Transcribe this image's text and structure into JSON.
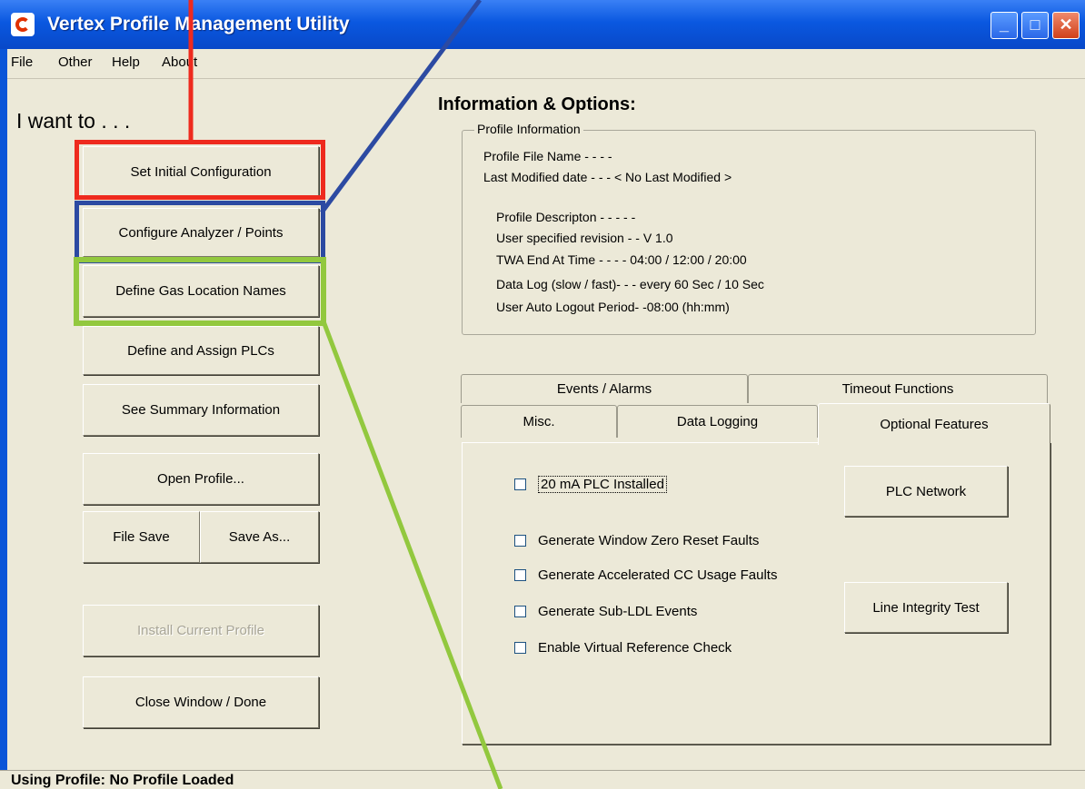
{
  "window": {
    "title": "Vertex Profile Management Utility",
    "buttons": {
      "minimize": "_",
      "maximize": "□",
      "close": "✕"
    }
  },
  "menu": [
    "File",
    "Other",
    "Help",
    "About"
  ],
  "left": {
    "heading": "I want to  . . .",
    "buttons": {
      "set_initial": "Set  Initial  Configuration",
      "configure_analyzer": "Configure  Analyzer / Points",
      "define_gas": "Define Gas Location Names",
      "define_plcs": "Define and Assign PLCs",
      "summary": "See  Summary  Information",
      "open_profile": "Open Profile...",
      "file_save": "File Save",
      "save_as": "Save As...",
      "install_profile": "Install Current Profile",
      "close_window": "Close Window / Done"
    }
  },
  "info": {
    "title": "Information & Options:",
    "group_label": "Profile Information",
    "file_name": "Profile File Name - - - -",
    "last_modified": "Last Modified date - - -    < No Last Modified >",
    "description": "Profile Descripton - - - - -",
    "revision": "User specified revision   - - V 1.0",
    "twa": "TWA End At Time - - - -  04:00  /  12:00  /  20:00",
    "datalog": "Data  Log (slow / fast)-  - - every 60 Sec / 10 Sec",
    "logout": "User Auto Logout Period-  -08:00 (hh:mm)"
  },
  "tabs": {
    "events": "Events / Alarms",
    "timeout": "Timeout Functions",
    "misc": "Misc.",
    "datalogging": "Data Logging",
    "optional": "Optional Features"
  },
  "optional": {
    "chk_plc": "20 mA PLC Installed",
    "chk_zero": "Generate Window Zero Reset Faults",
    "chk_cc": "Generate Accelerated CC Usage Faults",
    "chk_sub": "Generate Sub-LDL Events",
    "chk_virtual": "Enable Virtual Reference Check",
    "plc_network": "PLC Network",
    "line_test": "Line Integrity Test"
  },
  "status": "Using Profile:  No Profile Loaded",
  "annotation_colors": {
    "red": "#ee2a1e",
    "blue": "#2c4aa2",
    "green": "#92c83e"
  }
}
